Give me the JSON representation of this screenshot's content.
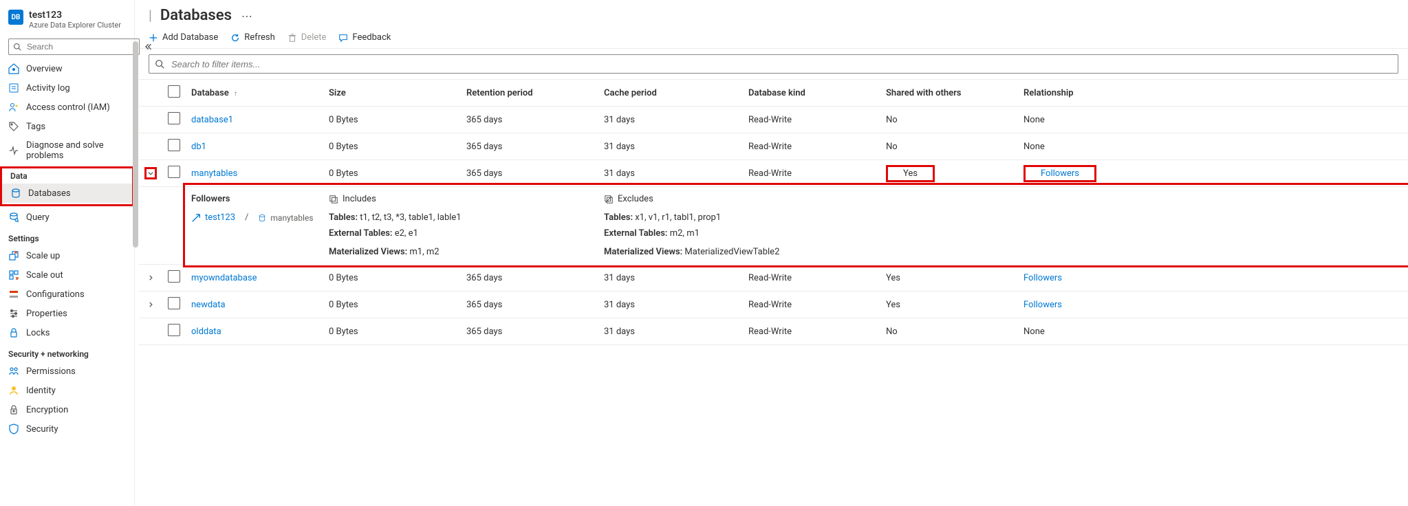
{
  "sidebar": {
    "title": "test123",
    "subtitle": "Azure Data Explorer Cluster",
    "search_placeholder": "Search",
    "items": [
      {
        "label": "Overview",
        "icon": "overview"
      },
      {
        "label": "Activity log",
        "icon": "activity"
      },
      {
        "label": "Access control (IAM)",
        "icon": "iam"
      },
      {
        "label": "Tags",
        "icon": "tag"
      },
      {
        "label": "Diagnose and solve problems",
        "icon": "diagnose"
      }
    ],
    "sections": [
      {
        "label": "Data",
        "items": [
          {
            "label": "Databases",
            "icon": "database",
            "selected": true
          },
          {
            "label": "Query",
            "icon": "query"
          }
        ]
      },
      {
        "label": "Settings",
        "items": [
          {
            "label": "Scale up",
            "icon": "scaleup"
          },
          {
            "label": "Scale out",
            "icon": "scaleout"
          },
          {
            "label": "Configurations",
            "icon": "config"
          },
          {
            "label": "Properties",
            "icon": "props"
          },
          {
            "label": "Locks",
            "icon": "lock"
          }
        ]
      },
      {
        "label": "Security + networking",
        "items": [
          {
            "label": "Permissions",
            "icon": "perm"
          },
          {
            "label": "Identity",
            "icon": "identity"
          },
          {
            "label": "Encryption",
            "icon": "encryption"
          },
          {
            "label": "Security",
            "icon": "security"
          }
        ]
      }
    ]
  },
  "page": {
    "title": "Databases"
  },
  "toolbar": {
    "add": "Add Database",
    "refresh": "Refresh",
    "delete": "Delete",
    "feedback": "Feedback"
  },
  "filter": {
    "placeholder": "Search to filter items..."
  },
  "table": {
    "headers": {
      "database": "Database",
      "size": "Size",
      "retention": "Retention period",
      "cache": "Cache period",
      "kind": "Database kind",
      "shared": "Shared with others",
      "relationship": "Relationship"
    },
    "sort_indicator": "↑",
    "rows": [
      {
        "name": "database1",
        "size": "0 Bytes",
        "retention": "365 days",
        "cache": "31 days",
        "kind": "Read-Write",
        "shared": "No",
        "relationship": "None",
        "rel_link": false,
        "expandable": false
      },
      {
        "name": "db1",
        "size": "0 Bytes",
        "retention": "365 days",
        "cache": "31 days",
        "kind": "Read-Write",
        "shared": "No",
        "relationship": "None",
        "rel_link": false,
        "expandable": false
      },
      {
        "name": "manytables",
        "size": "0 Bytes",
        "retention": "365 days",
        "cache": "31 days",
        "kind": "Read-Write",
        "shared": "Yes",
        "relationship": "Followers",
        "rel_link": true,
        "expandable": true,
        "expanded": true,
        "followers_panel": {
          "h_followers": "Followers",
          "h_includes": "Includes",
          "h_excludes": "Excludes",
          "link_label": "test123",
          "db_label": "manytables",
          "includes": {
            "tables_label": "Tables:",
            "tables": "t1, t2, t3, *3, table1, lable1",
            "ext_label": "External Tables:",
            "ext": "e2, e1",
            "mv_label": "Materialized Views:",
            "mv": "m1, m2"
          },
          "excludes": {
            "tables_label": "Tables:",
            "tables": "x1, v1, r1, tabl1, prop1",
            "ext_label": "External Tables:",
            "ext": "m2, m1",
            "mv_label": "Materialized Views:",
            "mv": "MaterializedViewTable2"
          }
        }
      },
      {
        "name": "myowndatabase",
        "size": "0 Bytes",
        "retention": "365 days",
        "cache": "31 days",
        "kind": "Read-Write",
        "shared": "Yes",
        "relationship": "Followers",
        "rel_link": true,
        "expandable": true
      },
      {
        "name": "newdata",
        "size": "0 Bytes",
        "retention": "365 days",
        "cache": "31 days",
        "kind": "Read-Write",
        "shared": "Yes",
        "relationship": "Followers",
        "rel_link": true,
        "expandable": true
      },
      {
        "name": "olddata",
        "size": "0 Bytes",
        "retention": "365 days",
        "cache": "31 days",
        "kind": "Read-Write",
        "shared": "No",
        "relationship": "None",
        "rel_link": false,
        "expandable": false
      }
    ]
  },
  "icons": {
    "db_logo": "DB"
  }
}
